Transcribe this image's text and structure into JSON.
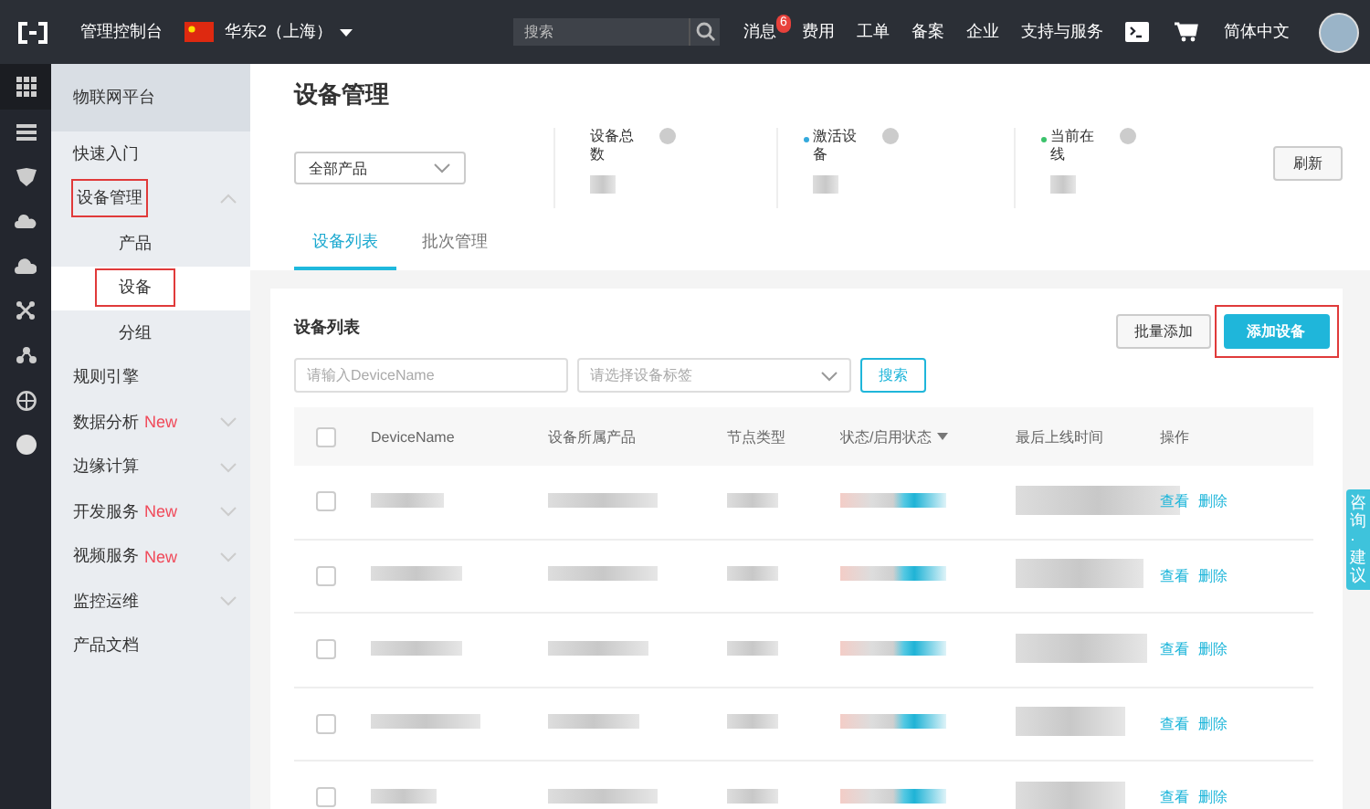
{
  "topbar": {
    "console_label": "管理控制台",
    "region": "华东2（上海）",
    "search": {
      "placeholder": "搜索"
    },
    "nav": [
      {
        "label": "消息",
        "badge": "6"
      },
      {
        "label": "费用"
      },
      {
        "label": "工单"
      },
      {
        "label": "备案"
      },
      {
        "label": "企业"
      },
      {
        "label": "支持与服务"
      }
    ],
    "language": "简体中文"
  },
  "sidebar": {
    "title": "物联网平台",
    "items": [
      {
        "label": "快速入门",
        "selected": false,
        "annotated": false
      },
      {
        "label": "设备管理",
        "selected": false,
        "annotated": true,
        "expanded": true,
        "children": [
          {
            "label": "产品",
            "selected": false,
            "annotated": false
          },
          {
            "label": "设备",
            "selected": true,
            "annotated": true
          },
          {
            "label": "分组",
            "selected": false,
            "annotated": false
          }
        ]
      },
      {
        "label": "规则引擎",
        "selected": false,
        "annotated": false
      },
      {
        "label": "数据分析",
        "selected": false,
        "annotated": false,
        "tag": "New",
        "expanded": false
      },
      {
        "label": "边缘计算",
        "selected": false,
        "annotated": false,
        "expanded": false
      },
      {
        "label": "开发服务",
        "selected": false,
        "annotated": false,
        "tag": "New",
        "expanded": false
      },
      {
        "label": "视频服务",
        "selected": false,
        "annotated": false,
        "tag": "New",
        "expanded": false
      },
      {
        "label": "监控运维",
        "selected": false,
        "annotated": false,
        "expanded": false
      },
      {
        "label": "产品文档",
        "selected": false,
        "annotated": false
      }
    ]
  },
  "page": {
    "title": "设备管理",
    "product_select": "全部产品",
    "stats": [
      {
        "label": "设备总数"
      },
      {
        "label": "激活设备",
        "color": "#33a9dc"
      },
      {
        "label": "当前在线",
        "color": "#3bc26b"
      }
    ],
    "refresh_button": "刷新",
    "tabs": [
      {
        "label": "设备列表",
        "selected": true
      },
      {
        "label": "批次管理",
        "selected": false
      }
    ]
  },
  "device_list": {
    "title": "设备列表",
    "batch_add_button": "批量添加",
    "add_button": {
      "label": "添加设备",
      "annotated": true
    },
    "name_search": {
      "placeholder": "请输入DeviceName"
    },
    "tag_select": {
      "placeholder": "请选择设备标签"
    },
    "search_button": "搜索",
    "columns": [
      "DeviceName",
      "设备所属产品",
      "节点类型",
      "状态/启用状态",
      "最后上线时间",
      "操作"
    ],
    "all_checked": false,
    "rows": [
      {
        "checked": false,
        "actions": [
          "查看",
          "删除"
        ]
      },
      {
        "checked": false,
        "actions": [
          "查看",
          "删除"
        ]
      },
      {
        "checked": false,
        "actions": [
          "查看",
          "删除"
        ]
      },
      {
        "checked": false,
        "actions": [
          "查看",
          "删除"
        ]
      },
      {
        "checked": false,
        "actions": [
          "查看",
          "删除"
        ]
      }
    ]
  },
  "feedback_tab": "咨询·建议"
}
